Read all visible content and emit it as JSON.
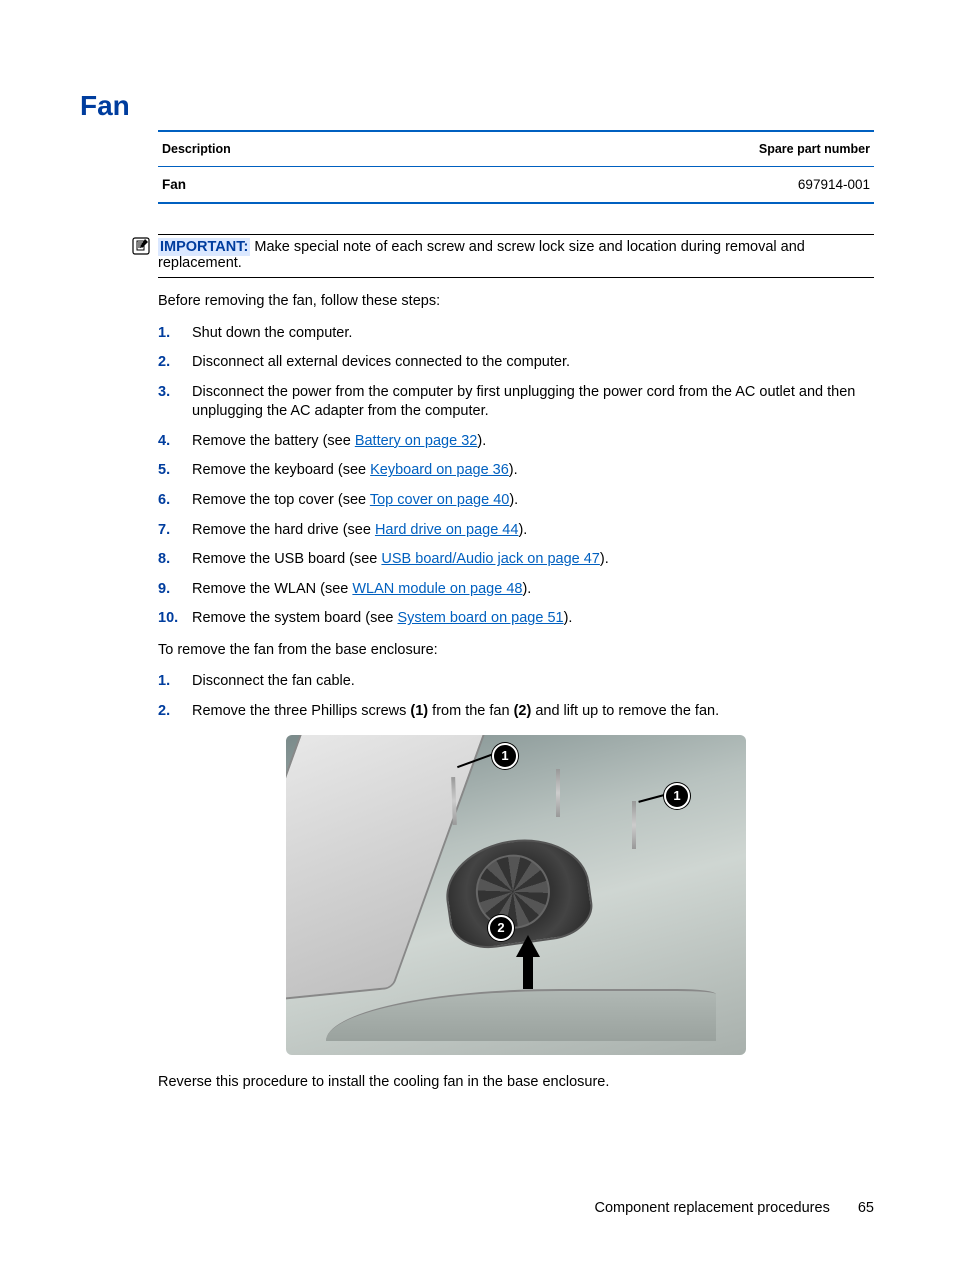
{
  "section_title": "Fan",
  "table": {
    "headers": {
      "description": "Description",
      "spare": "Spare part number"
    },
    "row": {
      "description": "Fan",
      "spare": "697914-001"
    }
  },
  "important": {
    "label": "IMPORTANT:",
    "text": "Make special note of each screw and screw lock size and location during removal and replacement."
  },
  "intro": "Before removing the fan, follow these steps:",
  "steps1": [
    {
      "n": "1.",
      "text_before": "Shut down the computer.",
      "link": "",
      "text_after": ""
    },
    {
      "n": "2.",
      "text_before": "Disconnect all external devices connected to the computer.",
      "link": "",
      "text_after": ""
    },
    {
      "n": "3.",
      "text_before": "Disconnect the power from the computer by first unplugging the power cord from the AC outlet and then unplugging the AC adapter from the computer.",
      "link": "",
      "text_after": ""
    },
    {
      "n": "4.",
      "text_before": "Remove the battery (see ",
      "link": "Battery on page 32",
      "text_after": ")."
    },
    {
      "n": "5.",
      "text_before": "Remove the keyboard (see ",
      "link": "Keyboard on page 36",
      "text_after": ")."
    },
    {
      "n": "6.",
      "text_before": "Remove the top cover (see ",
      "link": "Top cover on page 40",
      "text_after": ")."
    },
    {
      "n": "7.",
      "text_before": "Remove the hard drive (see ",
      "link": "Hard drive on page 44",
      "text_after": ")."
    },
    {
      "n": "8.",
      "text_before": "Remove the USB board (see ",
      "link": "USB board/Audio jack on page 47",
      "text_after": ")."
    },
    {
      "n": "9.",
      "text_before": "Remove the WLAN (see ",
      "link": "WLAN module on page 48",
      "text_after": ")."
    },
    {
      "n": "10.",
      "text_before": "Remove the system board (see ",
      "link": "System board on page 51",
      "text_after": ")."
    }
  ],
  "intro2": "To remove the fan from the base enclosure:",
  "steps2": [
    {
      "n": "1.",
      "html": "Disconnect the fan cable."
    },
    {
      "n": "2.",
      "html": "Remove the three Phillips screws <b>(1)</b> from the fan <b>(2)</b> and lift up to remove the fan."
    }
  ],
  "callouts": {
    "c1": "1",
    "c2": "2"
  },
  "closing": "Reverse this procedure to install the cooling fan in the base enclosure.",
  "footer": {
    "chapter": "Component replacement procedures",
    "page": "65"
  }
}
